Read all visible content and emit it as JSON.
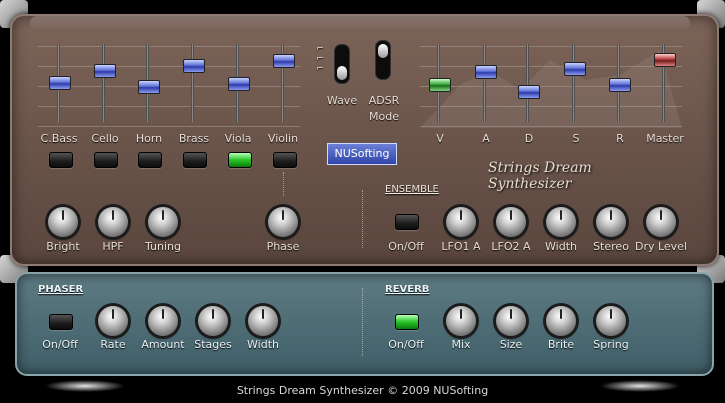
{
  "app": {
    "title": "Strings Dream Synthesizer",
    "brand": "NUSofting"
  },
  "string_section": {
    "faders": [
      {
        "label": "C.Bass",
        "level": 0.55
      },
      {
        "label": "Cello",
        "level": 0.72
      },
      {
        "label": "Horn",
        "level": 0.48
      },
      {
        "label": "Brass",
        "level": 0.78
      },
      {
        "label": "Viola",
        "level": 0.53
      },
      {
        "label": "Violin",
        "level": 0.86
      }
    ],
    "buttons_on": [
      false,
      false,
      false,
      false,
      true,
      false
    ]
  },
  "switches": {
    "wave_label": "Wave",
    "adsr_label": "ADSR",
    "mode_label": "Mode",
    "wave_glyph": "⌐⌐⌐"
  },
  "adsr_section": {
    "faders": [
      {
        "label": "V",
        "level": 0.52,
        "color": "green"
      },
      {
        "label": "A",
        "level": 0.7,
        "color": "blue"
      },
      {
        "label": "D",
        "level": 0.42,
        "color": "blue"
      },
      {
        "label": "S",
        "level": 0.74,
        "color": "blue"
      },
      {
        "label": "R",
        "level": 0.51,
        "color": "blue"
      },
      {
        "label": "Master",
        "level": 0.87,
        "color": "red"
      }
    ]
  },
  "logo_text": "NUSofting",
  "product_title": "Strings Dream Synthesizer",
  "top_knobs": [
    "Bright",
    "HPF",
    "Tuning",
    "Phase"
  ],
  "ensemble": {
    "title": "ENSEMBLE",
    "onoff_label": "On/Off",
    "knobs": [
      "LFO1 A",
      "LFO2 A",
      "Width",
      "Stereo",
      "Dry Level"
    ]
  },
  "phaser": {
    "title": "PHASER",
    "onoff_label": "On/Off",
    "knobs": [
      "Rate",
      "Amount",
      "Stages",
      "Width"
    ]
  },
  "reverb": {
    "title": "REVERB",
    "onoff_label": "On/Off",
    "knobs": [
      "Mix",
      "Size",
      "Brite",
      "Spring"
    ]
  },
  "footer": "Strings Dream Synthesizer © 2009 NUSofting",
  "colors": {
    "top_panel": "#6c564c",
    "bottom_panel": "#4a6a73",
    "fader_blue": "#4a5cc8",
    "led_green": "#28c428"
  }
}
